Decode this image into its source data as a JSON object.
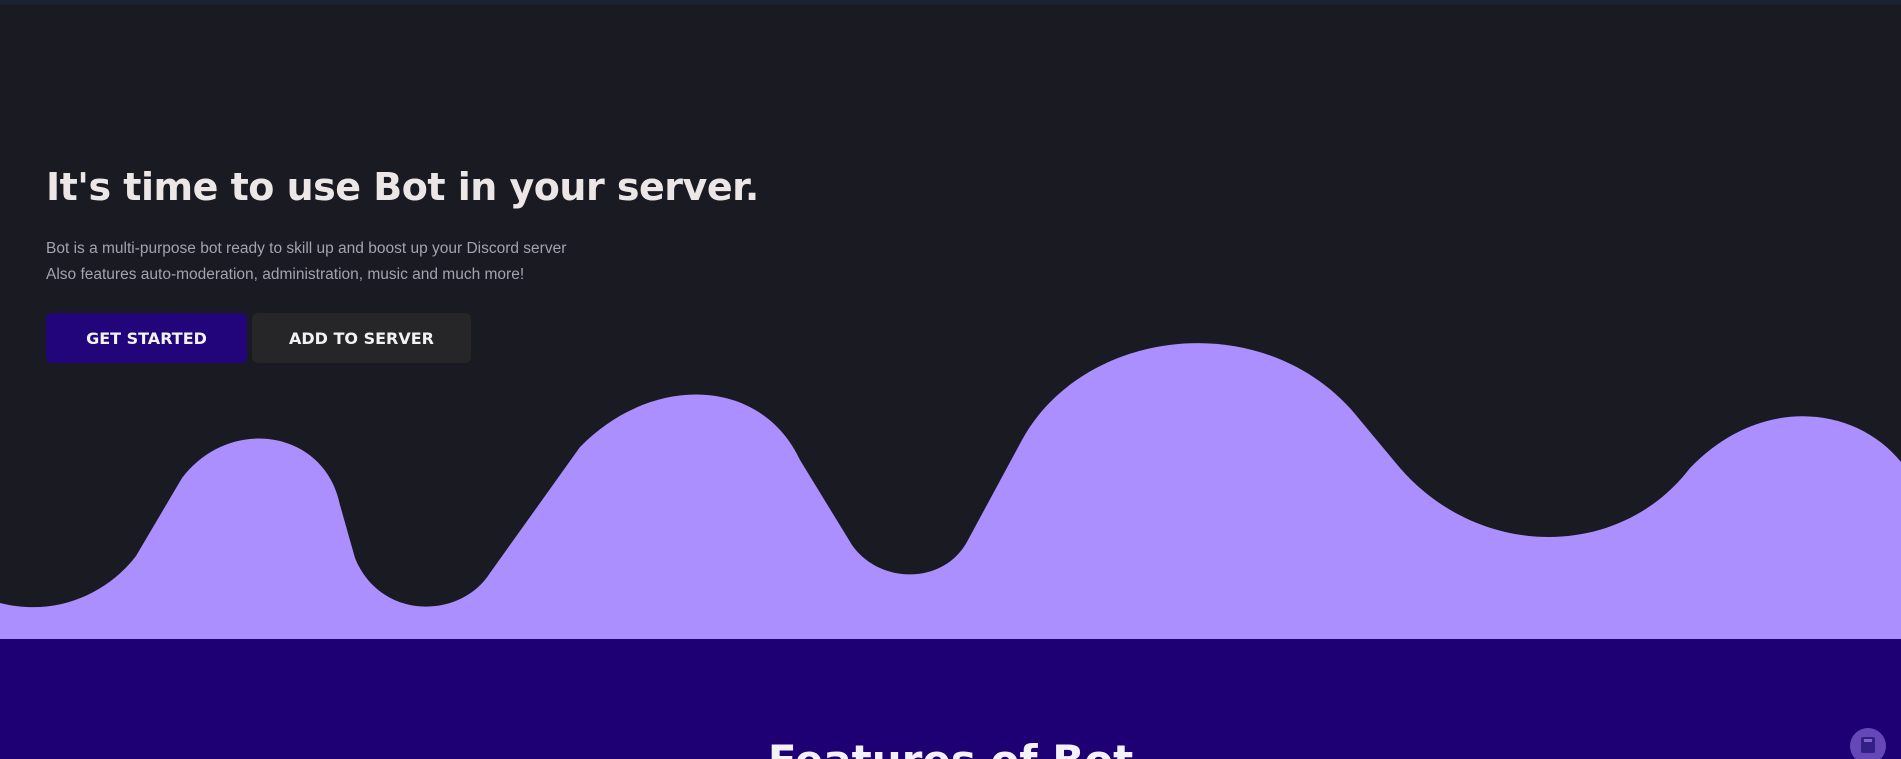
{
  "hero": {
    "title": "It's time to use Bot in your server.",
    "description_line1": "Bot is a multi-purpose bot ready to skill up and boost up your Discord server",
    "description_line2": "Also features auto-moderation, administration, music and much more!",
    "get_started_label": "GET STARTED",
    "add_to_server_label": "ADD TO SERVER"
  },
  "features": {
    "title": "Features of Bot"
  },
  "scroll_button": {
    "icon": "scroll-top-icon"
  },
  "colors": {
    "background": "#1a1a22",
    "accent_wave": "#ab8ffe",
    "primary_button": "#22057a",
    "secondary_button": "#262628",
    "features_background": "#1f0074"
  }
}
